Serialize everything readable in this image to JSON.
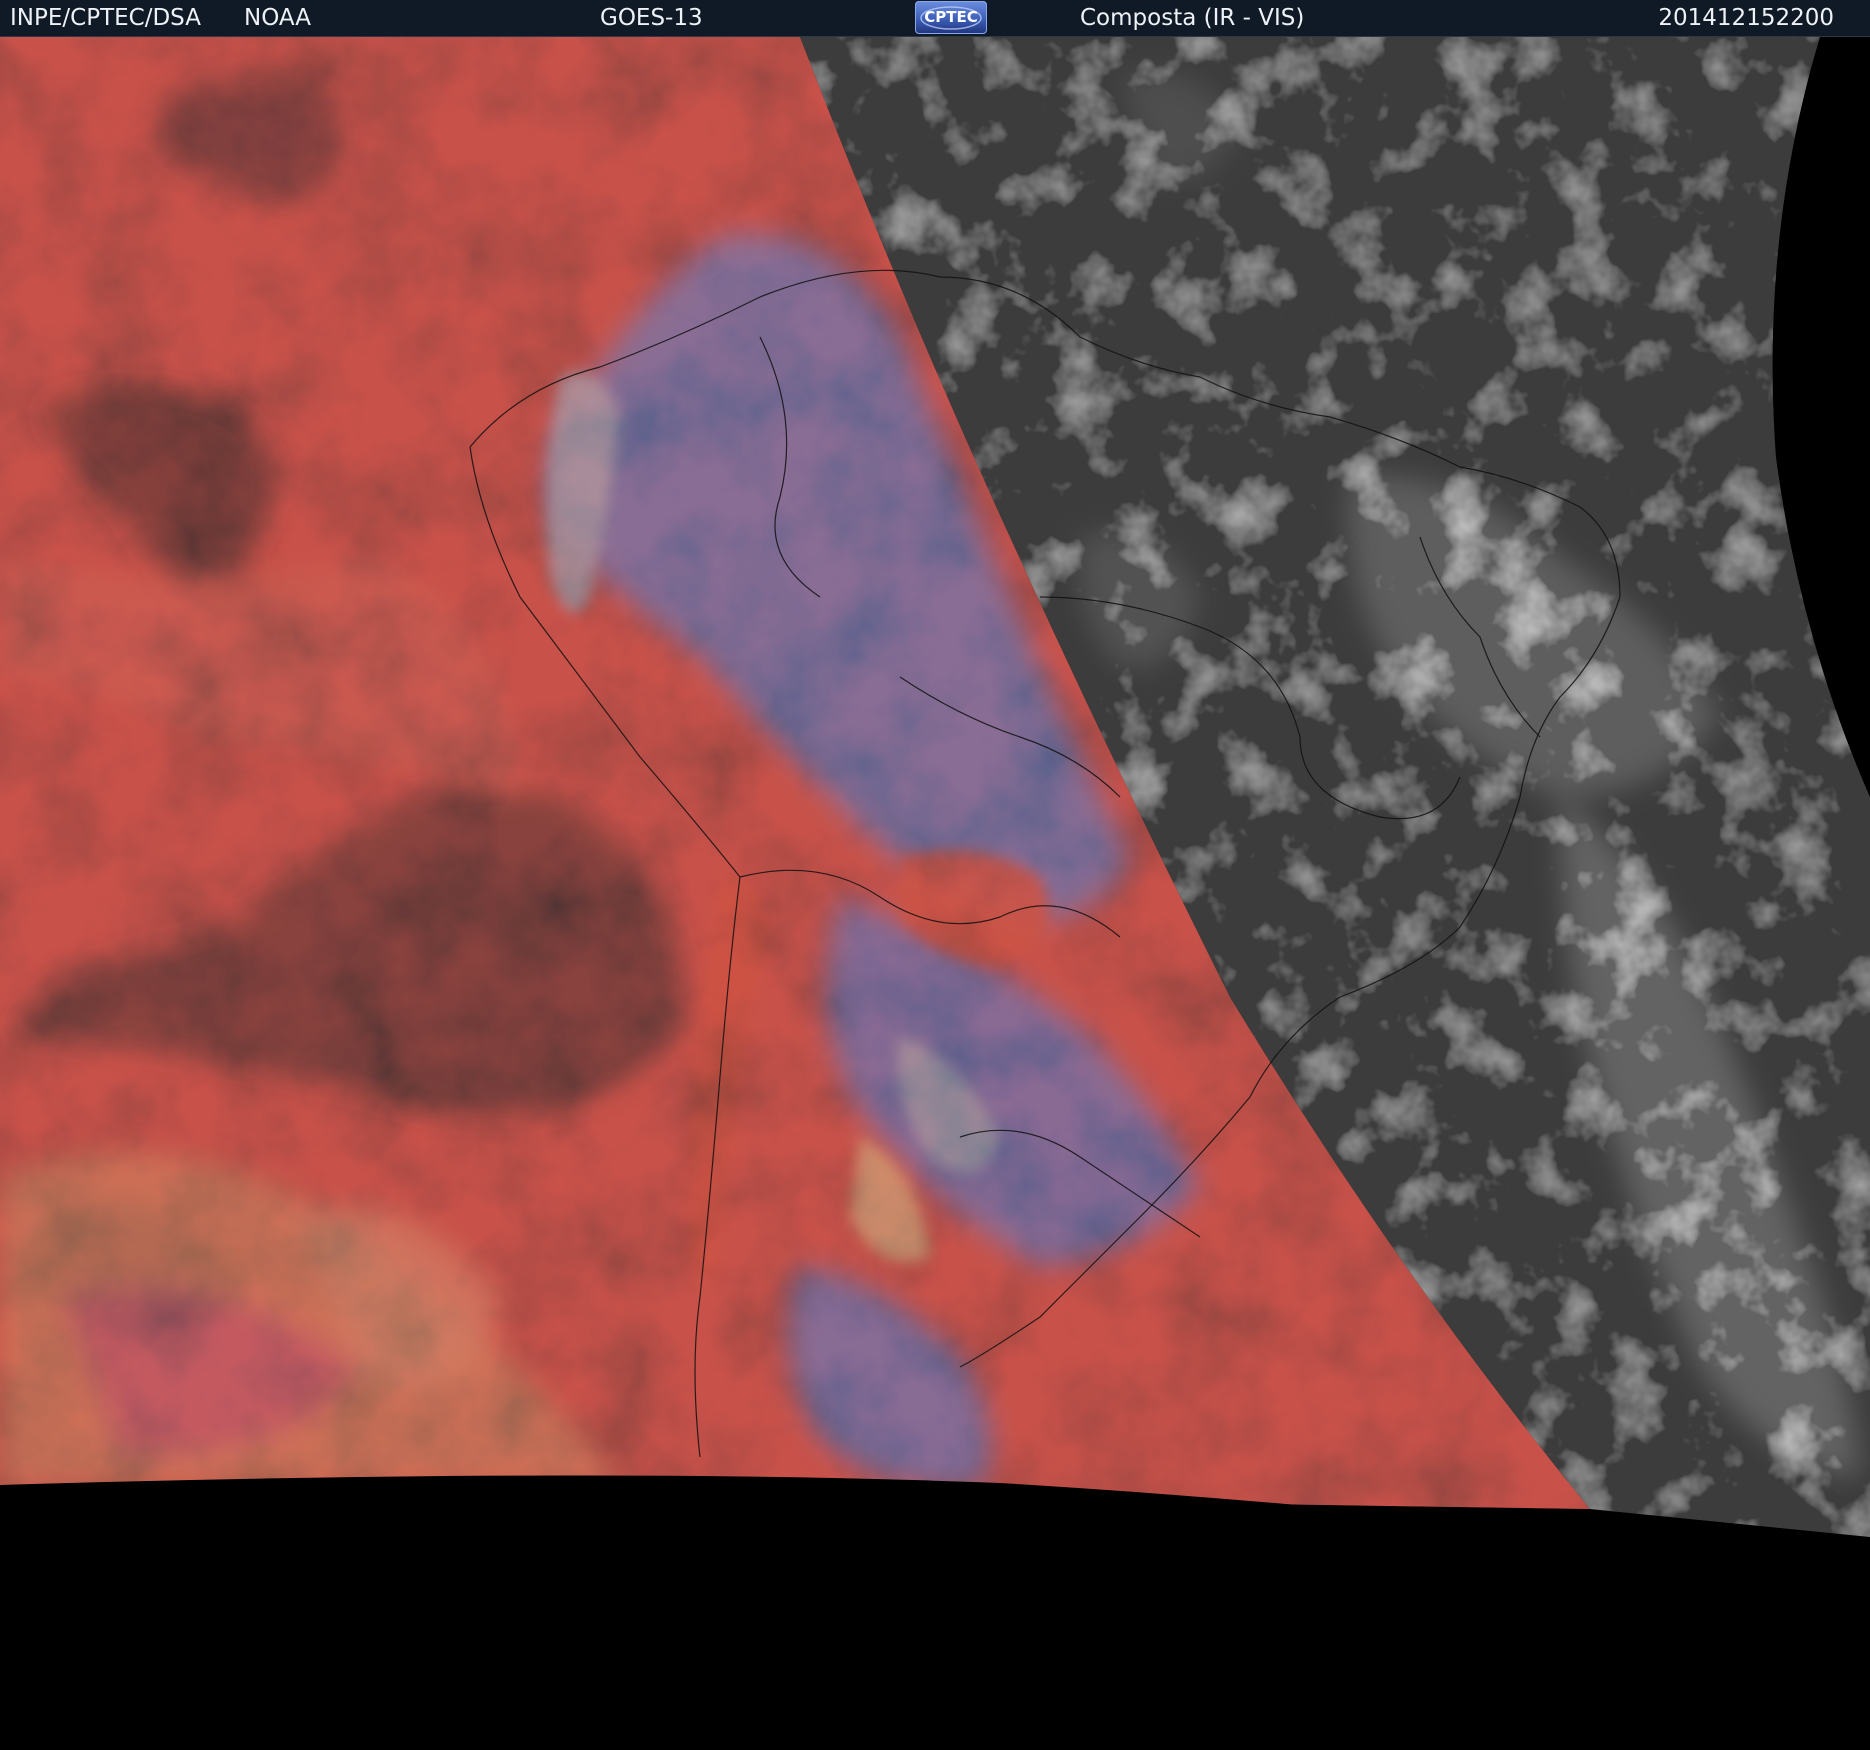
{
  "header": {
    "organization": "INPE/CPTEC/DSA",
    "agency": "NOAA",
    "satellite": "GOES-13",
    "logo_text": "CPTEC",
    "product": "Composta (IR - VIS)",
    "timestamp": "201412152200"
  },
  "colors": {
    "header_background": "#0f1a26",
    "header_text": "#eef2f6",
    "space": "#000000",
    "ir_clear_ocean": "#c8524a",
    "ir_dark_surface": "#3a2f30",
    "ir_cold_cloud_blue": "#3d8ff0",
    "ir_cloud_cyan": "#8fe0ff",
    "ir_cloud_yellow": "#d8c07a",
    "vis_dark": "#3c3c3c",
    "vis_cloud": "#c8c8c8",
    "boundary_lines": "#101010"
  },
  "icons": {
    "logo": "cptec-logo"
  }
}
